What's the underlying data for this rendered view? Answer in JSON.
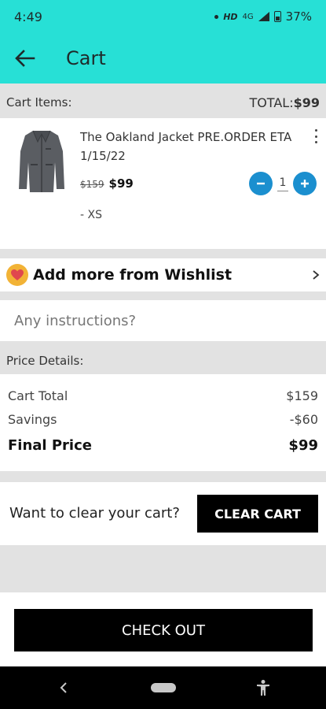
{
  "status_bar": {
    "time": "4:49",
    "network": "HD",
    "signal": "4G",
    "battery": "37%"
  },
  "app_bar": {
    "title": "Cart"
  },
  "cart_header": {
    "label": "Cart Items:",
    "total_label": "TOTAL:",
    "total_value": "$99"
  },
  "cart_items": [
    {
      "title": "The Oakland Jacket PRE.ORDER ETA 1/15/22",
      "original_price": "$159",
      "price": "$99",
      "quantity": "1",
      "variant": "- XS"
    }
  ],
  "wishlist": {
    "label": "Add more from Wishlist"
  },
  "instructions": {
    "placeholder": "Any instructions?"
  },
  "price_details": {
    "header": "Price Details:",
    "cart_total_label": "Cart Total",
    "cart_total_value": "$159",
    "savings_label": "Savings",
    "savings_value": "-$60",
    "final_label": "Final Price",
    "final_value": "$99"
  },
  "clear_cart": {
    "prompt": "Want to clear your cart?",
    "button": "CLEAR CART"
  },
  "checkout": {
    "button": "CHECK OUT"
  },
  "colors": {
    "accent": "#27e0d6",
    "qty_button": "#1b8fcf",
    "wishlist_badge": "#f2b336"
  }
}
